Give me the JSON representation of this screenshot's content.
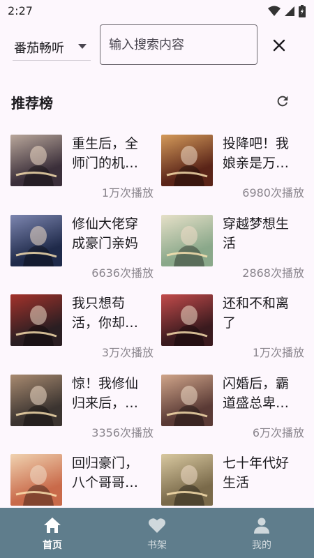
{
  "status": {
    "time": "2:27"
  },
  "search": {
    "source": "番茄畅听",
    "placeholder": "输入搜索内容",
    "value": ""
  },
  "section": {
    "title": "推荐榜"
  },
  "books": [
    {
      "title": "重生后，全师门的机…",
      "plays": "1万次播放",
      "colors": [
        "#3b2f3a",
        "#b9a79b"
      ]
    },
    {
      "title": "投降吧！我娘亲是万…",
      "plays": "6980次播放",
      "colors": [
        "#5a2418",
        "#d49a5a"
      ]
    },
    {
      "title": "修仙大佬穿成豪门亲妈",
      "plays": "6636次播放",
      "colors": [
        "#1f2a4a",
        "#7d86b0"
      ]
    },
    {
      "title": "穿越梦想生活",
      "plays": "2868次播放",
      "colors": [
        "#8aa88a",
        "#e6e0c8"
      ]
    },
    {
      "title": "我只想苟活，你却…",
      "plays": "3万次播放",
      "colors": [
        "#2a1e22",
        "#a3322b"
      ]
    },
    {
      "title": "还和不和离了",
      "plays": "1万次播放",
      "colors": [
        "#3a1a1e",
        "#c24b4b"
      ]
    },
    {
      "title": "惊！我修仙归来后，…",
      "plays": "3356次播放",
      "colors": [
        "#3b3430",
        "#a88a70"
      ]
    },
    {
      "title": "闪婚后，霸道盛总卑…",
      "plays": "6万次播放",
      "colors": [
        "#5a3a35",
        "#d0a58a"
      ]
    },
    {
      "title": "回归豪门，八个哥哥…",
      "plays": "",
      "colors": [
        "#c96a4a",
        "#f0d2b0"
      ]
    },
    {
      "title": "七十年代好生活",
      "plays": "",
      "colors": [
        "#7a6a4a",
        "#d8c8a0"
      ]
    }
  ],
  "nav": [
    {
      "label": "首页",
      "icon": "home-icon",
      "active": true
    },
    {
      "label": "书架",
      "icon": "heart-icon",
      "active": false
    },
    {
      "label": "我的",
      "icon": "person-icon",
      "active": false
    }
  ]
}
